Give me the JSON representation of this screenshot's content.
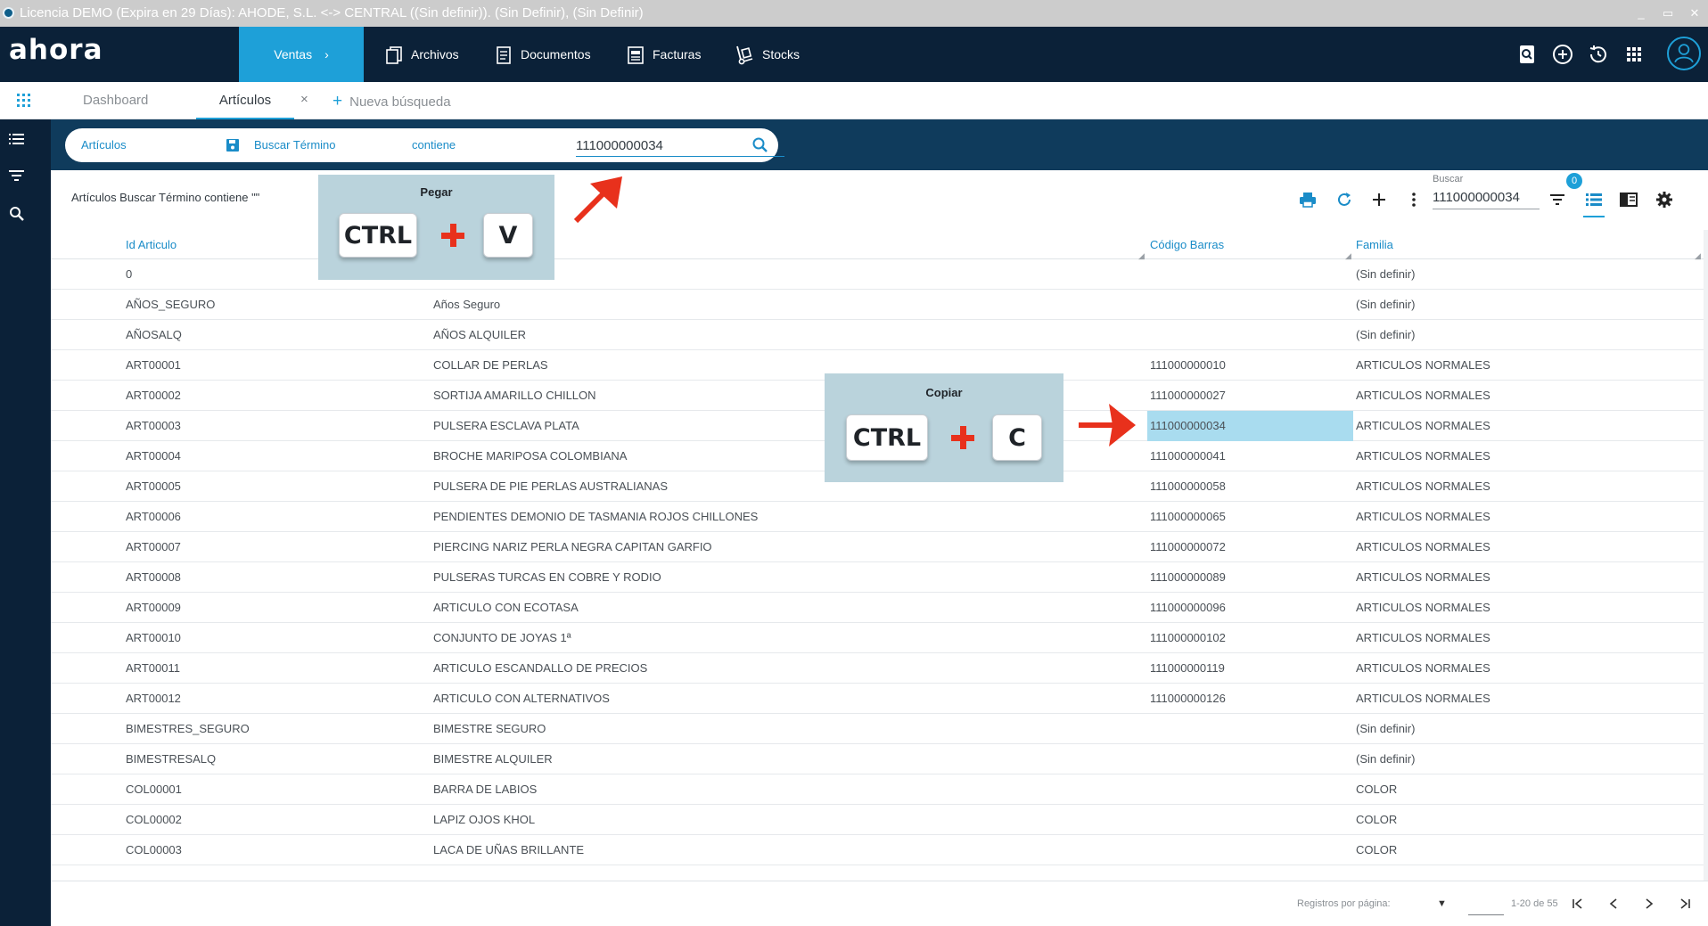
{
  "window": {
    "title": "Licencia DEMO (Expira en 29 Días): AHODE, S.L. <-> CENTRAL ((Sin definir)). (Sin Definir), (Sin Definir)",
    "controls": [
      "_",
      "▭",
      "✕"
    ]
  },
  "header": {
    "logo": "ahora",
    "nav": {
      "ventas": "Ventas",
      "archivos": "Archivos",
      "documentos": "Documentos",
      "facturas": "Facturas",
      "stocks": "Stocks"
    },
    "icons": [
      "search-doc-icon",
      "add-circle-icon",
      "history-icon",
      "apps-grid-icon",
      "user-avatar-icon"
    ]
  },
  "tabs": {
    "dashboard": "Dashboard",
    "articulos": "Artículos",
    "close": "×",
    "new_search": "Nueva búsqueda",
    "new_search_plus": "+"
  },
  "searchbar": {
    "entity": "Artículos",
    "field": "Buscar Término",
    "operator": "contiene",
    "value": "111000000034"
  },
  "toolbar": {
    "breadcrumb": "Artículos Buscar Término contiene \"\"",
    "buscar_label": "Buscar",
    "buscar_value": "111000000034",
    "filter_badge": "0"
  },
  "table": {
    "columns": [
      "Id Articulo",
      "Código Barras",
      "Familia"
    ],
    "rows": [
      {
        "id": "0",
        "desc": "",
        "code": "",
        "family": "(Sin definir)"
      },
      {
        "id": "AÑOS_SEGURO",
        "desc": "Años Seguro",
        "code": "",
        "family": "(Sin definir)"
      },
      {
        "id": "AÑOSALQ",
        "desc": "AÑOS ALQUILER",
        "code": "",
        "family": "(Sin definir)"
      },
      {
        "id": "ART00001",
        "desc": "COLLAR DE PERLAS",
        "code": "111000000010",
        "family": "ARTICULOS NORMALES"
      },
      {
        "id": "ART00002",
        "desc": "SORTIJA AMARILLO CHILLON",
        "code": "111000000027",
        "family": "ARTICULOS NORMALES"
      },
      {
        "id": "ART00003",
        "desc": "PULSERA ESCLAVA PLATA",
        "code": "111000000034",
        "family": "ARTICULOS NORMALES"
      },
      {
        "id": "ART00004",
        "desc": "BROCHE MARIPOSA COLOMBIANA",
        "code": "111000000041",
        "family": "ARTICULOS NORMALES"
      },
      {
        "id": "ART00005",
        "desc": "PULSERA DE PIE PERLAS AUSTRALIANAS",
        "code": "111000000058",
        "family": "ARTICULOS NORMALES"
      },
      {
        "id": "ART00006",
        "desc": "PENDIENTES DEMONIO DE TASMANIA ROJOS CHILLONES",
        "code": "111000000065",
        "family": "ARTICULOS NORMALES"
      },
      {
        "id": "ART00007",
        "desc": "PIERCING NARIZ PERLA NEGRA CAPITAN GARFIO",
        "code": "111000000072",
        "family": "ARTICULOS NORMALES"
      },
      {
        "id": "ART00008",
        "desc": "PULSERAS TURCAS EN COBRE Y RODIO",
        "code": "111000000089",
        "family": "ARTICULOS NORMALES"
      },
      {
        "id": "ART00009",
        "desc": "ARTICULO CON ECOTASA",
        "code": "111000000096",
        "family": "ARTICULOS NORMALES"
      },
      {
        "id": "ART00010",
        "desc": "CONJUNTO DE JOYAS 1ª",
        "code": "111000000102",
        "family": "ARTICULOS NORMALES"
      },
      {
        "id": "ART00011",
        "desc": "ARTICULO ESCANDALLO DE PRECIOS",
        "code": "111000000119",
        "family": "ARTICULOS NORMALES"
      },
      {
        "id": "ART00012",
        "desc": "ARTICULO CON ALTERNATIVOS",
        "code": "111000000126",
        "family": "ARTICULOS NORMALES"
      },
      {
        "id": "BIMESTRES_SEGURO",
        "desc": "BIMESTRE SEGURO",
        "code": "",
        "family": "(Sin definir)"
      },
      {
        "id": "BIMESTRESALQ",
        "desc": "BIMESTRE ALQUILER",
        "code": "",
        "family": "(Sin definir)"
      },
      {
        "id": "COL00001",
        "desc": "BARRA DE LABIOS",
        "code": "",
        "family": "COLOR"
      },
      {
        "id": "COL00002",
        "desc": "LAPIZ OJOS KHOL",
        "code": "",
        "family": "COLOR"
      },
      {
        "id": "COL00003",
        "desc": "LACA DE UÑAS BRILLANTE",
        "code": "",
        "family": "COLOR"
      }
    ]
  },
  "footer": {
    "per_page_label": "Registros por página:",
    "range": "1-20 de 55"
  },
  "overlays": {
    "paste": {
      "title": "Pegar",
      "key1": "CTRL",
      "key2": "V"
    },
    "copy": {
      "title": "Copiar",
      "key1": "CTRL",
      "key2": "C"
    }
  },
  "colors": {
    "header_bg": "#0b2138",
    "accent": "#1ea0d8",
    "search_strip": "#0f3b5c",
    "selection": "#a9dcef",
    "overlay_bg": "#bad3dc",
    "arrow_red": "#e8311c"
  }
}
